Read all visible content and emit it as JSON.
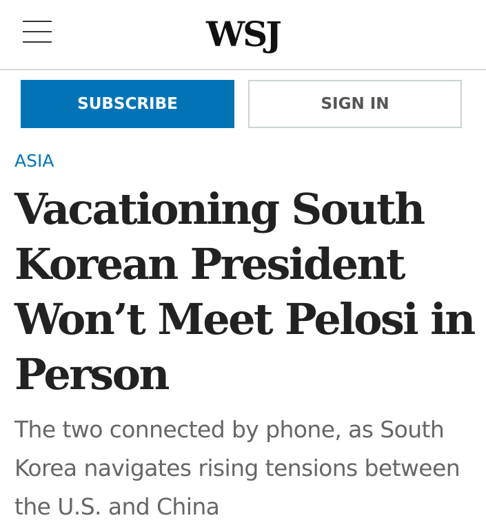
{
  "header": {
    "menu_icon": "hamburger-menu-icon",
    "logo": "WSJ"
  },
  "actions": {
    "subscribe_label": "SUBSCRIBE",
    "signin_label": "SIGN IN"
  },
  "article": {
    "section": "ASIA",
    "headline": "Vacationing South Korean President Won’t Meet Pelosi in Person",
    "dek": "The two connected by phone, as South Korea navigates rising tensions between the U.S. and China"
  },
  "colors": {
    "accent": "#0274b6",
    "headline": "#222222",
    "dek": "#666666",
    "signin_border": "#c9d3d3"
  }
}
